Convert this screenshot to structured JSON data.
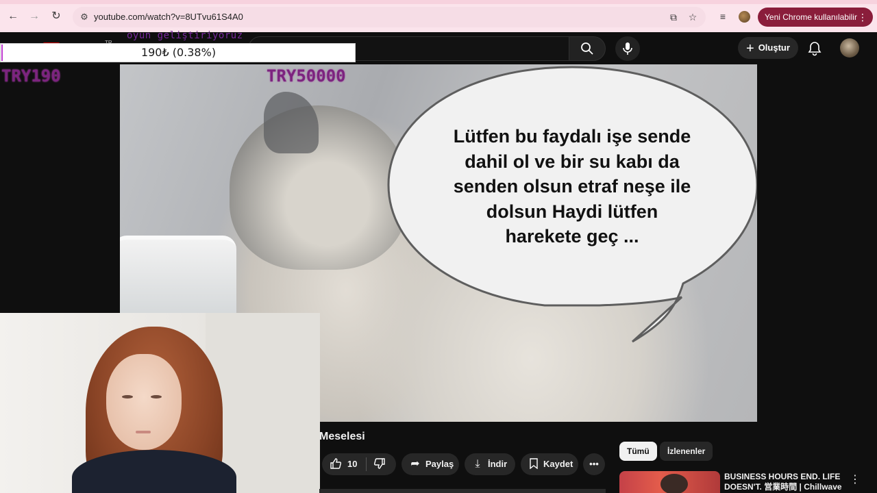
{
  "browser": {
    "url": "youtube.com/watch?v=8UTvu61S4A0",
    "update_label": "Yeni Chrome kullanılabilir",
    "back_icon": "arrow-left-icon",
    "forward_icon": "arrow-right-icon",
    "reload_icon": "reload-icon"
  },
  "youtube_header": {
    "create_label": "Oluştur",
    "search_placeholder": ""
  },
  "stream_overlay": {
    "channel_text": "oyun geliştiriyoruz",
    "tr_label": "TR",
    "donation_text": "190₺ (0.38%)",
    "donation_fraction": 0.0038,
    "donation_current": "TRY190",
    "donation_goal": "TRY50000"
  },
  "video": {
    "speech_bubble": [
      "Lütfen bu faydalı işe sende",
      "dahil ol ve bir su kabı da",
      "senden olsun etraf neşe ile",
      "dolsun Haydi lütfen",
      "harekete geç ..."
    ]
  },
  "below_video": {
    "title": "Meselesi",
    "like_count": "10",
    "share_label": "Paylaş",
    "download_label": "İndir",
    "save_label": "Kaydet"
  },
  "recommendations": {
    "chips": [
      "Tümü",
      "İzlenenler"
    ],
    "items": [
      {
        "title": "BUSINESS HOURS END. LIFE DOESN'T. 営業時間 | Chillwave"
      }
    ]
  }
}
